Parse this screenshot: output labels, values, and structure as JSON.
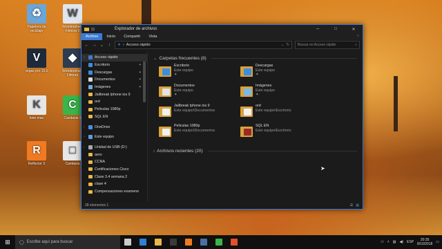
{
  "desktop": {
    "icons": [
      {
        "label": "Papelera de reciclaje",
        "color": "#6aa6d8",
        "glyph": "♻"
      },
      {
        "label": "Wondershare Filmora 9",
        "color": "#e0e6ee",
        "glyph": "W"
      },
      {
        "label": "vegas pro 15.0",
        "color": "#1d2a3a",
        "glyph": "V"
      },
      {
        "label": "Wondershare Filmora",
        "color": "#2c3c52",
        "glyph": "◆"
      },
      {
        "label": "kine mas",
        "color": "#e6e6e6",
        "glyph": "K"
      },
      {
        "label": "Camtasia 9",
        "color": "#39b54a",
        "glyph": "C"
      },
      {
        "label": "Reflector 3",
        "color": "#f07a22",
        "glyph": "R"
      },
      {
        "label": "Camtasia",
        "color": "#e7e7e7",
        "glyph": "□"
      }
    ]
  },
  "explorer": {
    "qa_icons": [
      "folder-icon",
      "pin-icon"
    ],
    "title": "Explorador de archivos",
    "ribbon_tabs": [
      "Archivo",
      "Inicio",
      "Compartir",
      "Vista"
    ],
    "address": {
      "back": "←",
      "forward": "→",
      "recent": "⌄",
      "up": "↑",
      "path_sep": "›",
      "path": "Acceso rápido",
      "search_placeholder": "Buscar en Acceso rápido"
    },
    "nav": [
      {
        "label": "Acceso rápido",
        "type": "top",
        "color": "#3a7bd5",
        "selected": true
      },
      {
        "label": "Escritorio",
        "type": "item",
        "color": "#3a8ee0",
        "pin": true
      },
      {
        "label": "Descargas",
        "type": "item",
        "color": "#3a8ee0",
        "pin": true
      },
      {
        "label": "Documentos",
        "type": "item",
        "color": "#dcdcdc",
        "pin": true
      },
      {
        "label": "Imágenes",
        "type": "item",
        "color": "#6ab0e0",
        "pin": true
      },
      {
        "label": "Jailbreak Iphone ios 9",
        "type": "folder"
      },
      {
        "label": "ord",
        "type": "folder"
      },
      {
        "label": "Peliculas 1080p",
        "type": "folder"
      },
      {
        "label": "SQL EN",
        "type": "folder"
      },
      {
        "label": "",
        "type": "spacer"
      },
      {
        "label": "OneDrive",
        "type": "top",
        "color": "#4a90e2"
      },
      {
        "label": "",
        "type": "spacer"
      },
      {
        "label": "Este equipo",
        "type": "top",
        "color": "#5aa0e0"
      },
      {
        "label": "",
        "type": "spacer"
      },
      {
        "label": "Unidad de USB (D:)",
        "type": "top",
        "color": "#aaaaaa"
      },
      {
        "label": "aero",
        "type": "folder"
      },
      {
        "label": "CCNA",
        "type": "folder"
      },
      {
        "label": "Certificaciones Cisco",
        "type": "folder"
      },
      {
        "label": "Clase 3.4 semana 2",
        "type": "folder"
      },
      {
        "label": "clase 4",
        "type": "folder"
      },
      {
        "label": "Compensaciones examene",
        "type": "folder"
      }
    ],
    "groups": {
      "frequent": "Carpetas frecuentes (8)",
      "recent": "Archivos recientes (20)"
    },
    "tiles": [
      {
        "name": "Escritorio",
        "location": "Este equipo",
        "front": "#3a8ee0",
        "pinned": true
      },
      {
        "name": "Descargas",
        "location": "Este equipo",
        "front": "#3a8ee0",
        "pinned": true
      },
      {
        "name": "Documentos",
        "location": "Este equipo",
        "front": "#e4e4e4",
        "pinned": true
      },
      {
        "name": "Imágenes",
        "location": "Este equipo",
        "front": "#7ab8e8",
        "pinned": true
      },
      {
        "name": "Jailbreak Iphone ios 9",
        "location": "Este equipo\\Documentos",
        "front": "#f2f2f2",
        "pinned": false
      },
      {
        "name": "ord",
        "location": "Este equipo\\Escritorio",
        "front": "#f2f2f2",
        "pinned": false
      },
      {
        "name": "Peliculas 1080p",
        "location": "Este equipo\\Documentos",
        "front": "#f2f2f2",
        "pinned": false
      },
      {
        "name": "SQL EN",
        "location": "Este equipo\\Escritorio",
        "front": "#9a2a2a",
        "pinned": false
      }
    ],
    "pin_glyph": "📌",
    "status": "28 elementos  1"
  },
  "taskbar": {
    "search_placeholder": "Escribe aquí para buscar",
    "apps": [
      {
        "name": "task-view",
        "color": "#cccccc"
      },
      {
        "name": "edge",
        "color": "#2f7fd6"
      },
      {
        "name": "explorer",
        "color": "#e8b84a"
      },
      {
        "name": "store",
        "color": "#3a3a3a"
      },
      {
        "name": "reflector",
        "color": "#f07a22"
      },
      {
        "name": "filmora",
        "color": "#4a6fa5"
      },
      {
        "name": "camtasia",
        "color": "#39b54a"
      },
      {
        "name": "recorder",
        "color": "#e0522a"
      }
    ],
    "tray": {
      "lang": "ESP",
      "time": "20:35",
      "date": "8/10/2018"
    }
  }
}
